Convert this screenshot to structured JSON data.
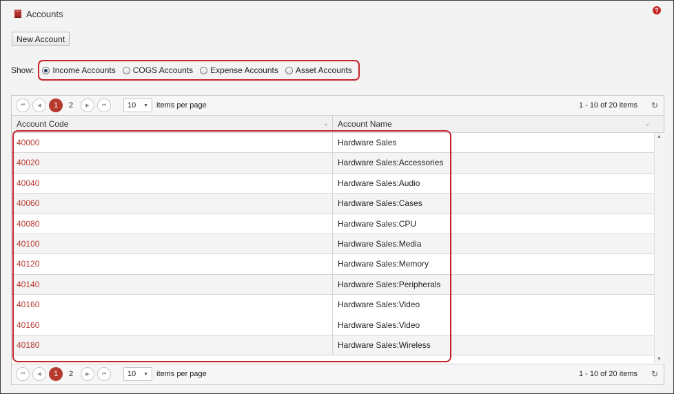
{
  "page": {
    "title": "Accounts",
    "help_icon": "help-icon"
  },
  "toolbar": {
    "new_account_label": "New Account"
  },
  "filter": {
    "label": "Show:",
    "options": [
      {
        "label": "Income Accounts",
        "selected": true
      },
      {
        "label": "COGS Accounts",
        "selected": false
      },
      {
        "label": "Expense Accounts",
        "selected": false
      },
      {
        "label": "Asset Accounts",
        "selected": false
      }
    ]
  },
  "pager": {
    "pages": [
      "1",
      "2"
    ],
    "current_page": "1",
    "page_size": "10",
    "items_per_page_label": "items per page",
    "info": "1 - 10 of 20 items"
  },
  "grid": {
    "columns": [
      "Account Code",
      "Account Name"
    ],
    "rows": [
      {
        "code": "40000",
        "name": "Hardware Sales"
      },
      {
        "code": "40020",
        "name": "Hardware Sales:Accessories"
      },
      {
        "code": "40040",
        "name": "Hardware Sales:Audio"
      },
      {
        "code": "40060",
        "name": "Hardware Sales:Cases"
      },
      {
        "code": "40080",
        "name": "Hardware Sales:CPU"
      },
      {
        "code": "40100",
        "name": "Hardware Sales:Media"
      },
      {
        "code": "40120",
        "name": "Hardware Sales:Memory"
      },
      {
        "code": "40140",
        "name": "Hardware Sales:Peripherals"
      },
      {
        "code": "40160",
        "name": "Hardware Sales:Video"
      },
      {
        "code": "40160",
        "name": "Hardware Sales:Video"
      },
      {
        "code": "40180",
        "name": "Hardware Sales:Wireless"
      }
    ]
  },
  "colors": {
    "accent": "#b73a2f",
    "highlight": "#c4242b"
  }
}
